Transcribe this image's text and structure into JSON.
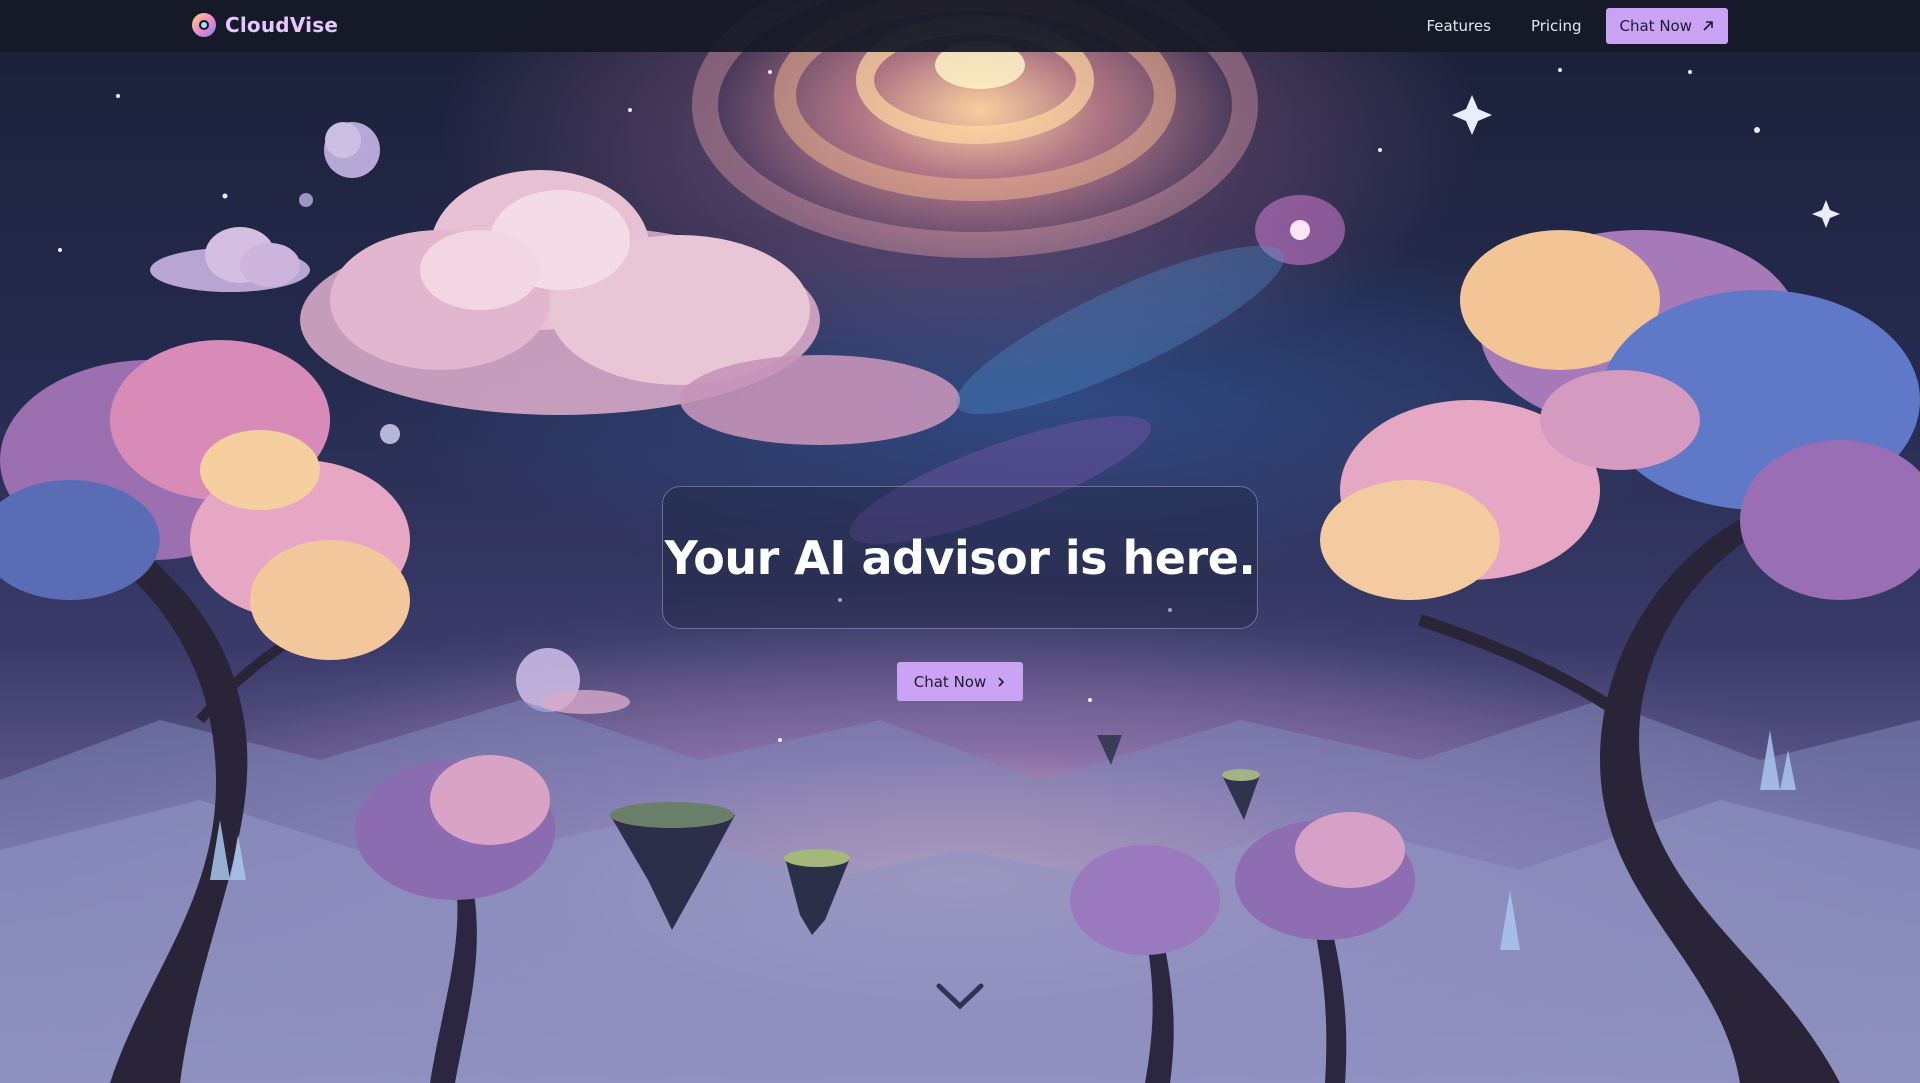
{
  "brand": {
    "name": "CloudVise",
    "logo_icon": "cloudvise-logo-icon"
  },
  "nav": {
    "links": [
      {
        "label": "Features"
      },
      {
        "label": "Pricing"
      }
    ],
    "cta_label": "Chat Now",
    "cta_icon": "arrow-up-right-icon"
  },
  "hero": {
    "title": "Your AI advisor is here.",
    "cta_label": "Chat Now",
    "cta_icon": "chevron-right-icon",
    "scroll_icon": "chevron-down-icon"
  },
  "colors": {
    "accent": "#cba3f5",
    "brand_text": "#e6c6ff",
    "navbar_bg": "#16182a",
    "sky_top": "#1b2038"
  }
}
